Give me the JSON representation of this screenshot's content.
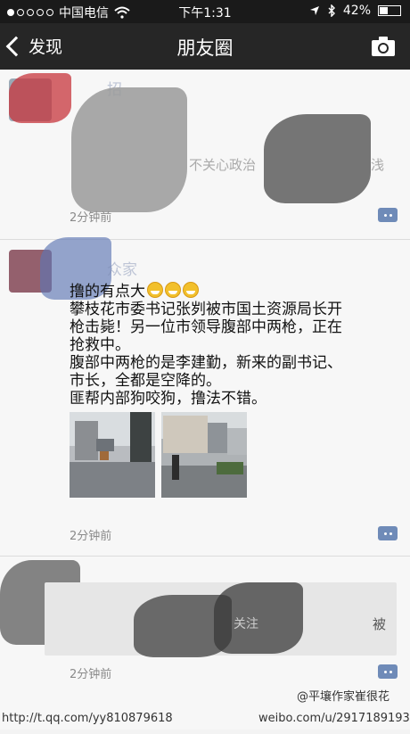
{
  "status": {
    "carrier": "中国电信",
    "time": "下午1:31",
    "battery": "42%",
    "battery_level": 0.42
  },
  "nav": {
    "back_label": "发现",
    "title": "朋友圈"
  },
  "posts": [
    {
      "fragments": [
        "招",
        "不关心政治",
        "浅"
      ],
      "time": "2分钟前"
    },
    {
      "name": "众家",
      "text_first": "撸的有点大",
      "text_lines": [
        "攀枝花市委书记张刿被市国土资源局长开",
        "枪击毙！另一位市领导腹部中两枪，正在",
        "抢救中。",
        "腹部中两枪的是李建勤，新来的副书记、",
        "市长，全都是空降的。",
        "匪帮内部狗咬狗，撸法不错。"
      ],
      "time": "2分钟前"
    },
    {
      "fragments": [
        "关注",
        "被"
      ],
      "time": "2分钟前"
    }
  ],
  "watermarks": {
    "left": "http://t.qq.com/yy810879618",
    "right": "weibo.com/u/2917189193",
    "right_handle": "@平壤作家崔很花"
  }
}
